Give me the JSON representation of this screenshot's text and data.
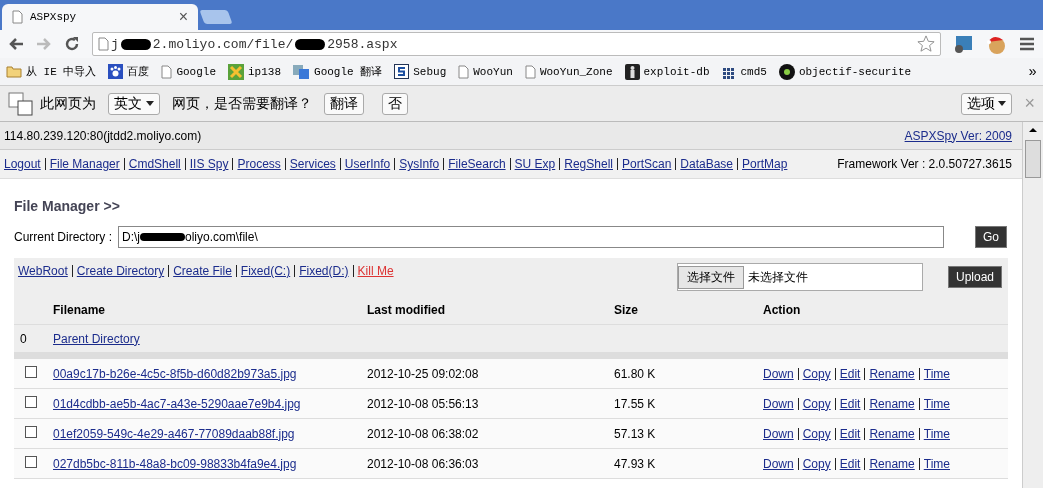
{
  "browser": {
    "tab_title": "ASPXspy",
    "tab_close": "×",
    "url_parts": [
      "j",
      "2.moliyo.com/file/",
      "2958.aspx"
    ]
  },
  "bookmarks": [
    {
      "label": "从 IE 中导入",
      "kind": "folder"
    },
    {
      "label": "百度",
      "kind": "paw"
    },
    {
      "label": "Google",
      "kind": "page"
    },
    {
      "label": "ip138",
      "kind": "tools"
    },
    {
      "label": "Google 翻译",
      "kind": "translate"
    },
    {
      "label": "Sebug",
      "kind": "letter"
    },
    {
      "label": "WooYun",
      "kind": "page"
    },
    {
      "label": "WooYun_Zone",
      "kind": "page"
    },
    {
      "label": "exploit-db",
      "kind": "figure"
    },
    {
      "label": "cmd5",
      "kind": "grid"
    },
    {
      "label": "objectif-securite",
      "kind": "circle"
    }
  ],
  "bookmarks_more": "»",
  "translate_bar": {
    "prefix": "此网页为",
    "language": "英文",
    "suffix": "网页，是否需要翻译？",
    "buttons": [
      "翻译",
      "否"
    ],
    "options": "选项",
    "close": "×"
  },
  "page": {
    "host": "114.80.239.120:80(jtdd2.moliyo.com)",
    "version": "ASPXSpy Ver: 2009",
    "nav": [
      "Logout",
      "File Manager",
      "CmdShell",
      "IIS Spy",
      "Process",
      "Services",
      "UserInfo",
      "SysInfo",
      "FileSearch",
      "SU Exp",
      "RegShell",
      "PortScan",
      "DataBase",
      "PortMap"
    ],
    "framework": "Framework Ver : 2.0.50727.3615"
  },
  "file_manager": {
    "title": "File Manager >>",
    "dir_label": "Current Directory :",
    "dir_parts": [
      "D:\\j",
      "oliyo.com\\file\\"
    ],
    "go": "Go",
    "links": [
      {
        "label": "WebRoot",
        "kind": "normal"
      },
      {
        "label": "Create Directory",
        "kind": "normal"
      },
      {
        "label": "Create File",
        "kind": "normal"
      },
      {
        "label": "Fixed(C:)",
        "kind": "normal"
      },
      {
        "label": "Fixed(D:)",
        "kind": "normal"
      },
      {
        "label": "Kill Me",
        "kind": "danger"
      }
    ],
    "file_button": "选择文件",
    "file_status": "未选择文件",
    "upload": "Upload",
    "columns": [
      "Filename",
      "Last modified",
      "Size",
      "Action"
    ],
    "parent": {
      "index": "0",
      "label": "Parent Directory"
    },
    "rows": [
      {
        "name": "00a9c17b-b26e-4c5c-8f5b-d60d82b973a5.jpg",
        "modified": "2012-10-25 09:02:08",
        "size": "61.80 K",
        "checked": false,
        "actions": [
          "Down",
          "Copy",
          "Edit",
          "Rename",
          "Time"
        ]
      },
      {
        "name": "01d4cdbb-ae5b-4ac7-a43e-5290aae7e9b4.jpg",
        "modified": "2012-10-08 05:56:13",
        "size": "17.55 K",
        "checked": false,
        "actions": [
          "Down",
          "Copy",
          "Edit",
          "Rename",
          "Time"
        ]
      },
      {
        "name": "01ef2059-549c-4e29-a467-77089daab88f.jpg",
        "modified": "2012-10-08 06:38:02",
        "size": "57.13 K",
        "checked": false,
        "actions": [
          "Down",
          "Copy",
          "Edit",
          "Rename",
          "Time"
        ]
      },
      {
        "name": "027db5bc-811b-48a8-bc09-98833b4fa9e4.jpg",
        "modified": "2012-10-08 06:36:03",
        "size": "47.93 K",
        "checked": false,
        "actions": [
          "Down",
          "Copy",
          "Edit",
          "Rename",
          "Time"
        ]
      }
    ]
  }
}
